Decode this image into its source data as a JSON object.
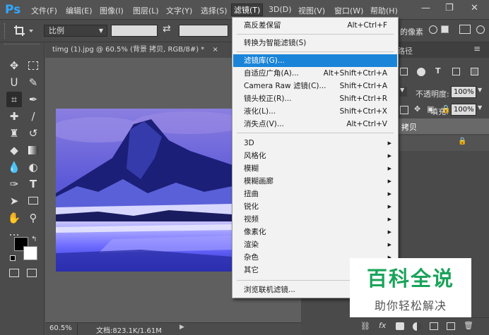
{
  "app": {
    "logo": "Ps"
  },
  "menubar": {
    "items": [
      "文件(F)",
      "编辑(E)",
      "图像(I)",
      "图层(L)",
      "文字(Y)",
      "选择(S)",
      "滤镜(T)",
      "3D(D)",
      "视图(V)",
      "窗口(W)",
      "帮助(H)"
    ],
    "active_index": 6
  },
  "window_controls": {
    "minimize": "—",
    "restore": "❐",
    "close": "✕"
  },
  "options_bar": {
    "crop_icon": "crop-icon",
    "ratio_label": "比例",
    "swap_icon": "⇄",
    "right_text": "的像素"
  },
  "document": {
    "tab_title": "timg (1).jpg @ 60.5% (背景 拷贝, RGB/8#) *",
    "tab_close": "×",
    "zoom": "60.5%",
    "doc_info": "文档:823.1K/1.61M"
  },
  "right_panel": {
    "panel_tab_suffix": "路径",
    "opacity_label": "不透明度:",
    "opacity_value": "100%",
    "fill_label": "填充:",
    "fill_value": "100%",
    "layer_name": "拷贝",
    "fx_label": "fx"
  },
  "filter_menu": {
    "items": [
      {
        "label": "高反差保留",
        "shortcut": "Alt+Ctrl+F"
      },
      {
        "label": "转换为智能滤镜(S)",
        "shortcut": ""
      },
      {
        "label": "滤镜库(G)...",
        "shortcut": "",
        "highlighted": true
      },
      {
        "label": "自适应广角(A)...",
        "shortcut": "Alt+Shift+Ctrl+A"
      },
      {
        "label": "Camera Raw 滤镜(C)...",
        "shortcut": "Shift+Ctrl+A"
      },
      {
        "label": "镜头校正(R)...",
        "shortcut": "Shift+Ctrl+R"
      },
      {
        "label": "液化(L)...",
        "shortcut": "Shift+Ctrl+X"
      },
      {
        "label": "消失点(V)...",
        "shortcut": "Alt+Ctrl+V"
      },
      {
        "label": "3D",
        "submenu": true
      },
      {
        "label": "风格化",
        "submenu": true
      },
      {
        "label": "模糊",
        "submenu": true
      },
      {
        "label": "模糊画廊",
        "submenu": true
      },
      {
        "label": "扭曲",
        "submenu": true
      },
      {
        "label": "锐化",
        "submenu": true
      },
      {
        "label": "视频",
        "submenu": true
      },
      {
        "label": "像素化",
        "submenu": true
      },
      {
        "label": "渲染",
        "submenu": true
      },
      {
        "label": "杂色",
        "submenu": true
      },
      {
        "label": "其它",
        "submenu": true
      },
      {
        "label": "浏览联机滤镜...",
        "shortcut": ""
      }
    ],
    "submenu_arrow": "▶"
  },
  "watermark": {
    "title": "百科全说",
    "subtitle": "助你轻松解决",
    "color": "#1aa35a"
  },
  "colors": {
    "accent": "#1a84d8",
    "menu_bg": "#f2f2f2",
    "app_bg": "#535353"
  }
}
